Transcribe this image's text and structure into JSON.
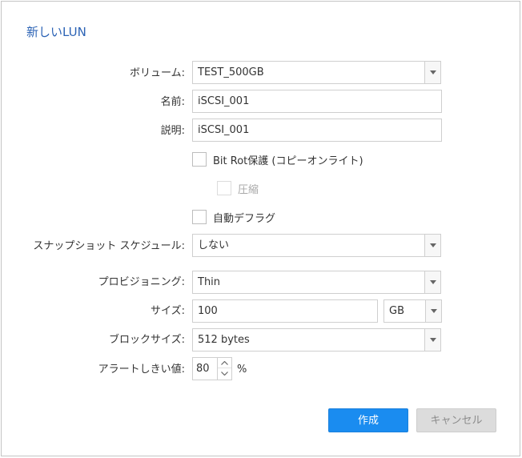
{
  "dialog": {
    "title": "新しいLUN",
    "volume": {
      "label": "ボリューム:",
      "value": "TEST_500GB"
    },
    "name": {
      "label": "名前:",
      "value": "iSCSI_001"
    },
    "description": {
      "label": "説明:",
      "value": "iSCSI_001"
    },
    "bitrot": {
      "label": "Bit Rot保護 (コピーオンライト)",
      "checked": false
    },
    "compression": {
      "label": "圧縮",
      "checked": false,
      "disabled": true
    },
    "defrag": {
      "label": "自動デフラグ",
      "checked": false
    },
    "snapshot_schedule": {
      "label": "スナップショット スケジュール:",
      "value": "しない"
    },
    "provisioning": {
      "label": "プロビジョニング:",
      "value": "Thin"
    },
    "size": {
      "label": "サイズ:",
      "value": "100",
      "unit": "GB"
    },
    "block_size": {
      "label": "ブロックサイズ:",
      "value": "512 bytes"
    },
    "alert_threshold": {
      "label": "アラートしきい値:",
      "value": "80",
      "unit": "%"
    },
    "buttons": {
      "create": "作成",
      "cancel": "キャンセル"
    }
  },
  "colors": {
    "accent": "#1a8cf0",
    "title": "#2c63b5",
    "disabled_text": "#a8a8a8"
  }
}
